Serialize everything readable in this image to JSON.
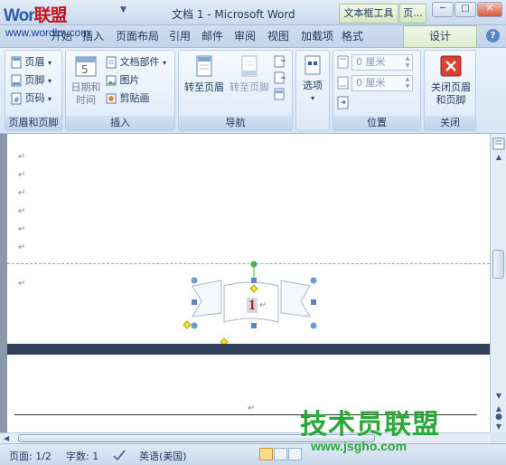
{
  "window": {
    "title": "文档 1 - Microsoft Word",
    "logo_text_a": "Wor",
    "logo_text_b": "联盟",
    "ctx_tab_group": "文本框工具",
    "ctx_tab_group2": "页..."
  },
  "watermark": {
    "url_top": "www.wordlm.com",
    "brand": "技术员联盟",
    "url_bottom": "www.jsgho.com"
  },
  "tabs": [
    "开始",
    "插入",
    "页面布局",
    "引用",
    "邮件",
    "审阅",
    "视图",
    "加载项"
  ],
  "tab_format": "格式",
  "tab_design": "设计",
  "ribbon": {
    "groups": {
      "header_footer": {
        "label": "页眉和页脚",
        "items": [
          "页眉",
          "页脚",
          "页码"
        ]
      },
      "insert": {
        "label": "插入",
        "date_time": "日期和\n时间",
        "items": [
          "文档部件",
          "图片",
          "剪贴画"
        ]
      },
      "nav": {
        "label": "导航",
        "goto_header": "转至页眉",
        "goto_footer": "转至页脚"
      },
      "options": {
        "label": "选项"
      },
      "position": {
        "label": "位置",
        "header_top": "0 厘米",
        "footer_bottom": "0 厘米"
      },
      "close": {
        "label": "关闭",
        "button": "关闭页眉\n和页脚"
      }
    }
  },
  "document": {
    "field_number": "1",
    "pilcrow": "↵"
  },
  "statusbar": {
    "page": "页面: 1/2",
    "words": "字数: 1",
    "language": "英语(美国)"
  },
  "colors": {
    "accent_red": "#c4161c",
    "watermark_green": "#2aa838",
    "context_tab_green": "#dcebcd"
  }
}
